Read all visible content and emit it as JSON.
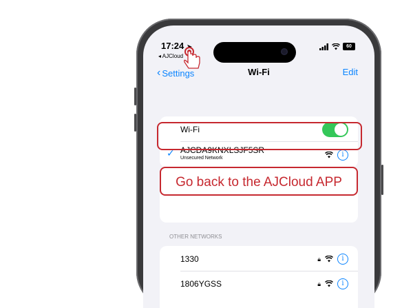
{
  "status": {
    "time": "17:24",
    "back_app": "◂ AJCloud"
  },
  "nav": {
    "back_label": "Settings",
    "title": "Wi-Fi",
    "edit_label": "Edit"
  },
  "wifi_toggle": {
    "label": "Wi-Fi",
    "on": true
  },
  "connected": {
    "ssid": "AJCDA9KNXLSJF5SR",
    "subtitle": "Unsecured Network"
  },
  "banner": {
    "text": "Go back to the AJCloud APP"
  },
  "other_networks": {
    "header": "OTHER NETWORKS",
    "items": [
      {
        "ssid": "1330",
        "secured": true
      },
      {
        "ssid": "1806YGSS",
        "secured": true
      }
    ]
  },
  "colors": {
    "accent": "#0a84ff",
    "toggle_on": "#34c759",
    "highlight": "#c6282f"
  }
}
